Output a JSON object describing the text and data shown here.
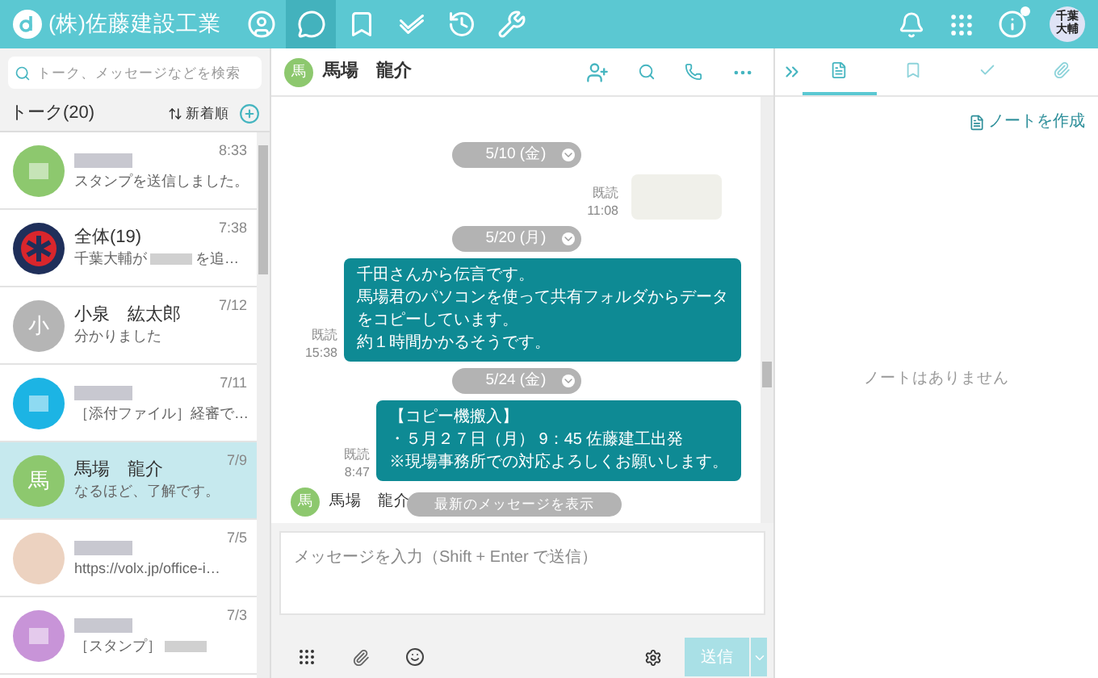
{
  "header": {
    "title": "(株)佐藤建設工業",
    "nav": [
      {
        "kind": "user",
        "selected": false
      },
      {
        "kind": "chat",
        "selected": true
      },
      {
        "kind": "bookmark",
        "selected": false
      },
      {
        "kind": "check",
        "selected": false
      },
      {
        "kind": "history",
        "selected": false
      },
      {
        "kind": "wrench",
        "selected": false
      }
    ],
    "user_avatar": [
      "千葉",
      "大輔"
    ],
    "info_badge": true
  },
  "sidebar": {
    "search": {
      "placeholder": "トーク、メッセージなどを検索"
    },
    "title": "トーク(20)",
    "sort": "新着順",
    "conversations": [
      {
        "avatar": {
          "kind": "blurred",
          "color": "#8dc86e"
        },
        "time": "8:33",
        "preview": "スタンプを送信しました。",
        "selected": false
      },
      {
        "avatar": {
          "kind": "logo",
          "color": "#1f2f5a"
        },
        "name": "全体(19)",
        "time": "7:38",
        "preview": "千葉大輔が",
        "preview_tail": "を追…",
        "selected": false
      },
      {
        "avatar": {
          "kind": "letter",
          "text": "小",
          "color": "#b5b5b5"
        },
        "name": "小泉　紘太郎",
        "time": "7/12",
        "preview": "分かりました",
        "selected": false
      },
      {
        "avatar": {
          "kind": "blurred",
          "color": "#1cb4e4"
        },
        "time": "7/11",
        "preview": "［添付ファイル］経審で…",
        "selected": false
      },
      {
        "avatar": {
          "kind": "letter",
          "text": "馬",
          "color": "#8dc86e"
        },
        "name": "馬場　龍介",
        "time": "7/9",
        "preview": "なるほど、了解です。",
        "selected": true
      },
      {
        "avatar": {
          "kind": "photo",
          "color": "#ecd2c0"
        },
        "time": "7/5",
        "preview": "https://volx.jp/office-i…",
        "selected": false
      },
      {
        "avatar": {
          "kind": "blurred",
          "color": "#c894d8"
        },
        "time": "7/3",
        "preview": "［スタンプ］",
        "preview_blur": true,
        "selected": false
      }
    ]
  },
  "chat": {
    "avatar": "馬",
    "name": "馬場　龍介",
    "messages": [
      {
        "kind": "date",
        "text": "5/10 (金)"
      },
      {
        "kind": "sticker",
        "read": "既読",
        "time": "11:08"
      },
      {
        "kind": "date",
        "text": "5/20 (月)"
      },
      {
        "kind": "outgoing",
        "read": "既読",
        "time": "15:38",
        "lines": [
          "千田さんから伝言です。",
          "馬場君のパソコンを使って共有フォルダからデータ",
          "をコピーしています。",
          "約１時間かかるそうです。"
        ]
      },
      {
        "kind": "date",
        "text": "5/24 (金)"
      },
      {
        "kind": "outgoing",
        "read": "既読",
        "time": "8:47",
        "lines": [
          "【コピー機搬入】",
          "・５月２７日（月） 9：45 佐藤建工出発",
          "※現場事務所での対応よろしくお願いします。"
        ]
      },
      {
        "kind": "incoming",
        "avatar": "馬",
        "name": "馬場　龍介"
      }
    ],
    "latest_button": "最新のメッセージを表示",
    "input": {
      "placeholder": "メッセージを入力（Shift + Enter で送信）"
    },
    "send": {
      "label": "送信",
      "disabled": true
    }
  },
  "notes": {
    "tabs": [
      {
        "kind": "note",
        "selected": true
      },
      {
        "kind": "bookmark",
        "selected": false
      },
      {
        "kind": "check",
        "selected": false
      },
      {
        "kind": "clip",
        "selected": false
      }
    ],
    "create": "ノートを作成",
    "empty": "ノートはありません"
  }
}
